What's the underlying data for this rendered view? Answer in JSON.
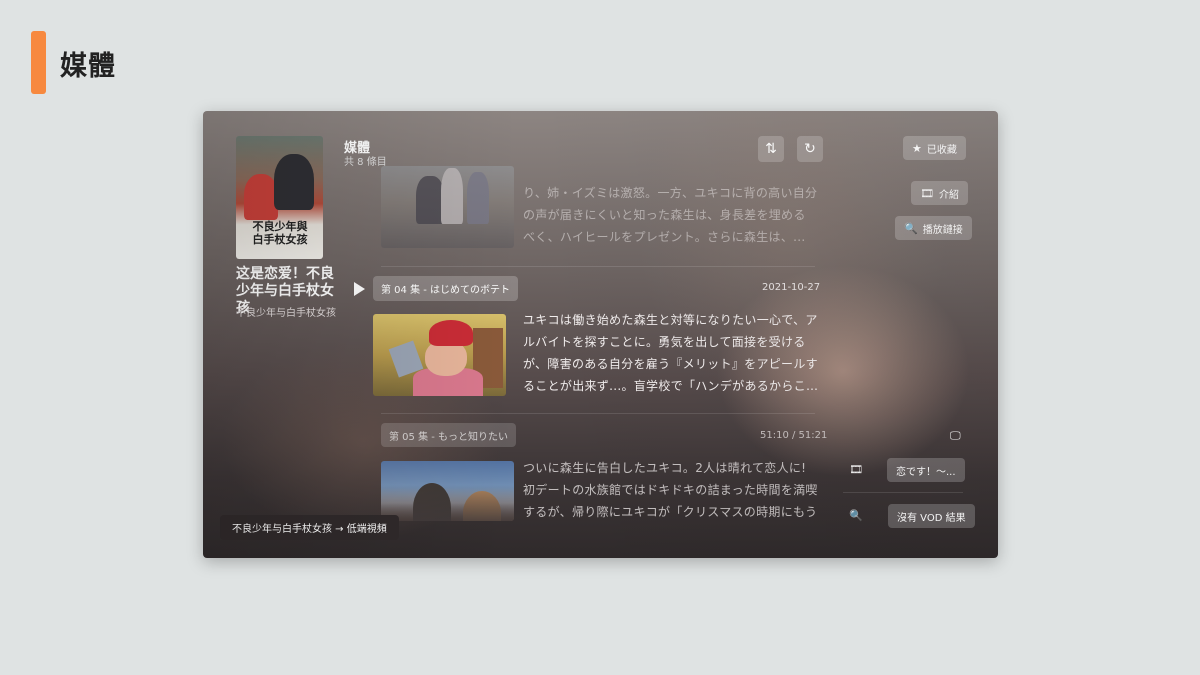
{
  "page": {
    "title": "媒體"
  },
  "poster": {
    "art_text_line1": "不良少年與",
    "art_text_line2": "白手杖女孩"
  },
  "show": {
    "title": "这是恋爱！不良少年与白手杖女孩",
    "subtitle": "不良少年与白手杖女孩"
  },
  "list": {
    "title": "媒體",
    "count": "共 8 條目"
  },
  "toolbar": {
    "sort_icon": "⇅",
    "refresh_icon": "↻"
  },
  "actions": {
    "favorite": {
      "icon": "★",
      "label": "已收藏"
    },
    "intro": {
      "icon": "🎞",
      "label": "介紹"
    },
    "play_link": {
      "icon": "🔍",
      "label": "播放鏈接"
    }
  },
  "episodes": [
    {
      "desc_lines": [
        "り、姉・イズミは激怒。一方、ユキコに背の高い自分",
        "の声が届きにくいと知った森生は、身長差を埋める",
        "べく、ハイヒールをプレゼント。さらに森生は、..."
      ]
    },
    {
      "tag": "第 04 集 - はじめてのボテト",
      "date": "2021-10-27",
      "desc_lines": [
        "ユキコは働き始めた森生と対等になりたい一心で、ア",
        "ルバイトを探すことに。勇気を出して面接を受ける",
        "が、障害のある自分を雇う『メリット』をアピールす",
        "ることが出来ず...。盲学校で「ハンデがあるからこ..."
      ]
    },
    {
      "tag": "第 05 集 - もっと知りたい",
      "date": "51:10 / 51:21",
      "desc_lines": [
        "ついに森生に告白したユキコ。2人は晴れて恋人に!",
        "初デートの水族館ではドキドキの詰まった時間を満喫",
        "するが、帰り際にユキコが「クリスマスの時期にもう"
      ]
    }
  ],
  "side": {
    "monitor_icon": "🖵",
    "film_icon": "🎞",
    "film_label": "恋です！～...",
    "search_icon": "🔍",
    "search_label": "沒有 VOD 結果"
  },
  "toast": {
    "label": "不良少年与白手杖女孩 → 低端視頻"
  }
}
